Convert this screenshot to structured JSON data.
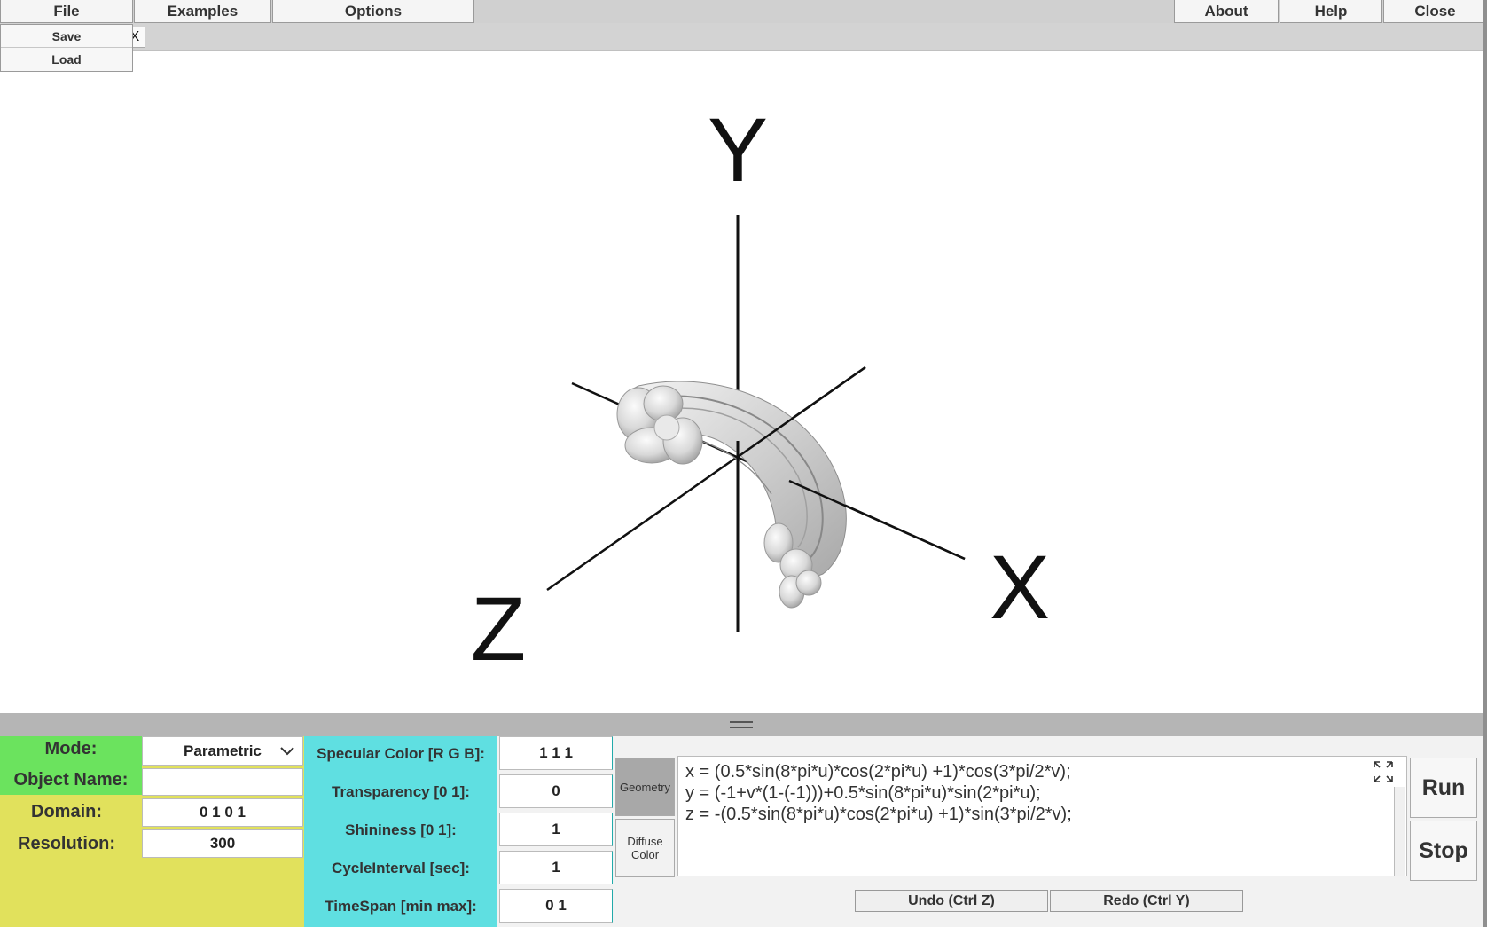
{
  "menu": {
    "file": "File",
    "examples": "Examples",
    "options": "Options",
    "about": "About",
    "help": "Help",
    "close": "Close"
  },
  "file_menu": {
    "save": "Save",
    "load": "Load"
  },
  "tab_close": "X",
  "axes": {
    "x": "X",
    "y": "Y",
    "z": "Z"
  },
  "settings": {
    "mode_label": "Mode:",
    "mode_value": "Parametric",
    "object_name_label": "Object Name:",
    "object_name_value": "",
    "domain_label": "Domain:",
    "domain_value": "0 1 0 1",
    "resolution_label": "Resolution:",
    "resolution_value": "300"
  },
  "material": {
    "specular_label": "Specular Color [R G B]:",
    "specular_value": "1 1 1",
    "transparency_label": "Transparency [0 1]:",
    "transparency_value": "0",
    "shininess_label": "Shininess [0 1]:",
    "shininess_value": "1",
    "cycle_label": "CycleInterval [sec]:",
    "cycle_value": "1",
    "timespan_label": "TimeSpan [min max]:",
    "timespan_value": "0 1"
  },
  "tabs": {
    "geometry": "Geometry",
    "diffuse_line1": "Diffuse",
    "diffuse_line2": "Color"
  },
  "editor": {
    "line1": "x = (0.5*sin(8*pi*u)*cos(2*pi*u) +1)*cos(3*pi/2*v);",
    "line2": "y = (-1+v*(1-(-1)))+0.5*sin(8*pi*u)*sin(2*pi*u);",
    "line3": "z = -(0.5*sin(8*pi*u)*cos(2*pi*u) +1)*sin(3*pi/2*v);"
  },
  "actions": {
    "run": "Run",
    "stop": "Stop",
    "undo": "Undo (Ctrl Z)",
    "redo": "Redo (Ctrl Y)"
  }
}
